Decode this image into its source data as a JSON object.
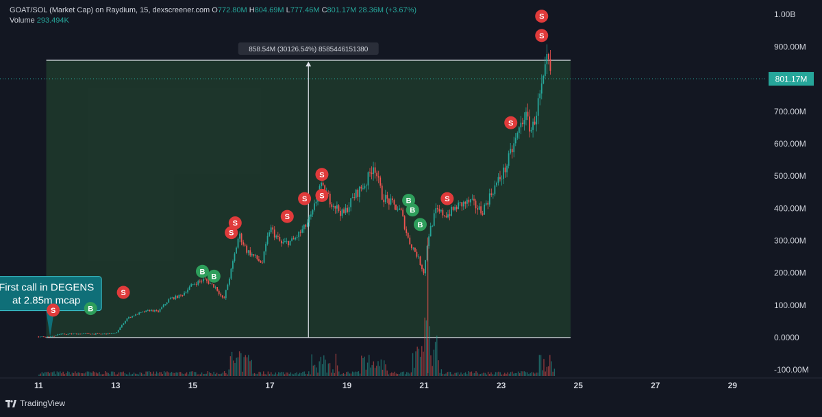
{
  "header": {
    "symbol": "GOAT/SOL (Market Cap) on Raydium, 15, dexscreener.com",
    "o_label": "O",
    "o_value": "772.80M",
    "h_label": "H",
    "h_value": "804.69M",
    "l_label": "L",
    "l_value": "777.46M",
    "c_label": "C",
    "c_value": "801.17M",
    "change": "28.36M (+3.67%)"
  },
  "volume": {
    "label": "Volume",
    "value": "293.494K"
  },
  "branding": {
    "name": "TradingView"
  },
  "colors": {
    "background": "#131722",
    "up": "#26a69a",
    "down": "#ef5350",
    "buy_marker": "#2e9e5b",
    "sell_marker": "#e03b3b",
    "range_fill": "#1f3a2c",
    "annotation": "#0f6f78"
  },
  "chart_data": {
    "type": "candlestick",
    "title": "GOAT/SOL (Market Cap)",
    "x_ticks": [
      "11",
      "13",
      "15",
      "17",
      "19",
      "21",
      "23",
      "25",
      "27",
      "29"
    ],
    "y_ticks": [
      "1.00B",
      "900.00M",
      "800.00M",
      "700.00M",
      "600.00M",
      "500.00M",
      "400.00M",
      "300.00M",
      "200.00M",
      "100.00M",
      "0.0000",
      "-100.00M"
    ],
    "y_tick_values": [
      1000,
      900,
      800,
      700,
      600,
      500,
      400,
      300,
      200,
      100,
      0,
      -100
    ],
    "ylim": [
      -125,
      1045
    ],
    "xlim": [
      10.0,
      29.9
    ],
    "current_price": {
      "label": "801.17M",
      "value": 801.17
    },
    "price_path": [
      [
        11.0,
        2.85
      ],
      [
        11.25,
        2.9
      ],
      [
        11.35,
        2.85
      ],
      [
        11.5,
        10
      ],
      [
        11.8,
        11
      ],
      [
        12.2,
        12
      ],
      [
        12.6,
        11
      ],
      [
        13.0,
        13
      ],
      [
        13.3,
        60
      ],
      [
        13.6,
        75
      ],
      [
        13.9,
        85
      ],
      [
        14.1,
        80
      ],
      [
        14.4,
        120
      ],
      [
        14.7,
        130
      ],
      [
        15.0,
        165
      ],
      [
        15.3,
        180
      ],
      [
        15.6,
        155
      ],
      [
        15.8,
        115
      ],
      [
        16.0,
        210
      ],
      [
        16.2,
        320
      ],
      [
        16.4,
        270
      ],
      [
        16.6,
        250
      ],
      [
        16.8,
        230
      ],
      [
        17.0,
        340
      ],
      [
        17.3,
        290
      ],
      [
        17.6,
        300
      ],
      [
        17.9,
        340
      ],
      [
        18.1,
        380
      ],
      [
        18.3,
        470
      ],
      [
        18.6,
        420
      ],
      [
        18.9,
        380
      ],
      [
        19.2,
        440
      ],
      [
        19.5,
        480
      ],
      [
        19.7,
        540
      ],
      [
        19.9,
        440
      ],
      [
        20.2,
        410
      ],
      [
        20.4,
        390
      ],
      [
        20.6,
        300
      ],
      [
        20.8,
        260
      ],
      [
        21.0,
        200
      ],
      [
        21.1,
        310
      ],
      [
        21.3,
        390
      ],
      [
        21.6,
        380
      ],
      [
        21.9,
        410
      ],
      [
        22.2,
        420
      ],
      [
        22.5,
        390
      ],
      [
        22.8,
        460
      ],
      [
        23.1,
        520
      ],
      [
        23.4,
        620
      ],
      [
        23.6,
        690
      ],
      [
        23.8,
        640
      ],
      [
        23.95,
        720
      ],
      [
        24.1,
        790
      ],
      [
        24.2,
        860
      ],
      [
        24.3,
        801.17
      ]
    ],
    "spike_low": {
      "x": 21.1,
      "value": -110
    },
    "volume_bars_approx_peak_x": [
      16.2,
      18.4,
      19.7,
      21.0,
      21.1,
      24.3
    ],
    "range_measure": {
      "x_start": 11.2,
      "x_end": 24.8,
      "y_low": 0,
      "y_high": 858.54,
      "label": "858.54M (30126.54%) 8585446151380"
    },
    "signals": [
      {
        "type": "S",
        "x": 11.38,
        "value": 85
      },
      {
        "type": "B",
        "x": 12.35,
        "value": 90
      },
      {
        "type": "S",
        "x": 13.2,
        "value": 140
      },
      {
        "type": "B",
        "x": 15.25,
        "value": 205
      },
      {
        "type": "B",
        "x": 15.55,
        "value": 190
      },
      {
        "type": "S",
        "x": 16.0,
        "value": 325
      },
      {
        "type": "S",
        "x": 16.1,
        "value": 355
      },
      {
        "type": "S",
        "x": 17.45,
        "value": 375
      },
      {
        "type": "S",
        "x": 17.9,
        "value": 430
      },
      {
        "type": "S",
        "x": 18.35,
        "value": 505
      },
      {
        "type": "S",
        "x": 18.35,
        "value": 440
      },
      {
        "type": "B",
        "x": 20.6,
        "value": 425
      },
      {
        "type": "B",
        "x": 20.7,
        "value": 395
      },
      {
        "type": "B",
        "x": 20.9,
        "value": 350
      },
      {
        "type": "S",
        "x": 21.6,
        "value": 430
      },
      {
        "type": "S",
        "x": 23.25,
        "value": 665
      },
      {
        "type": "S",
        "x": 24.05,
        "value": 935
      },
      {
        "type": "S",
        "x": 24.05,
        "value": 995
      }
    ],
    "annotation": {
      "text_line1": "First call in DEGENS",
      "text_line2": "at 2.85m mcap",
      "x": 11.3,
      "value": 2.85
    }
  }
}
